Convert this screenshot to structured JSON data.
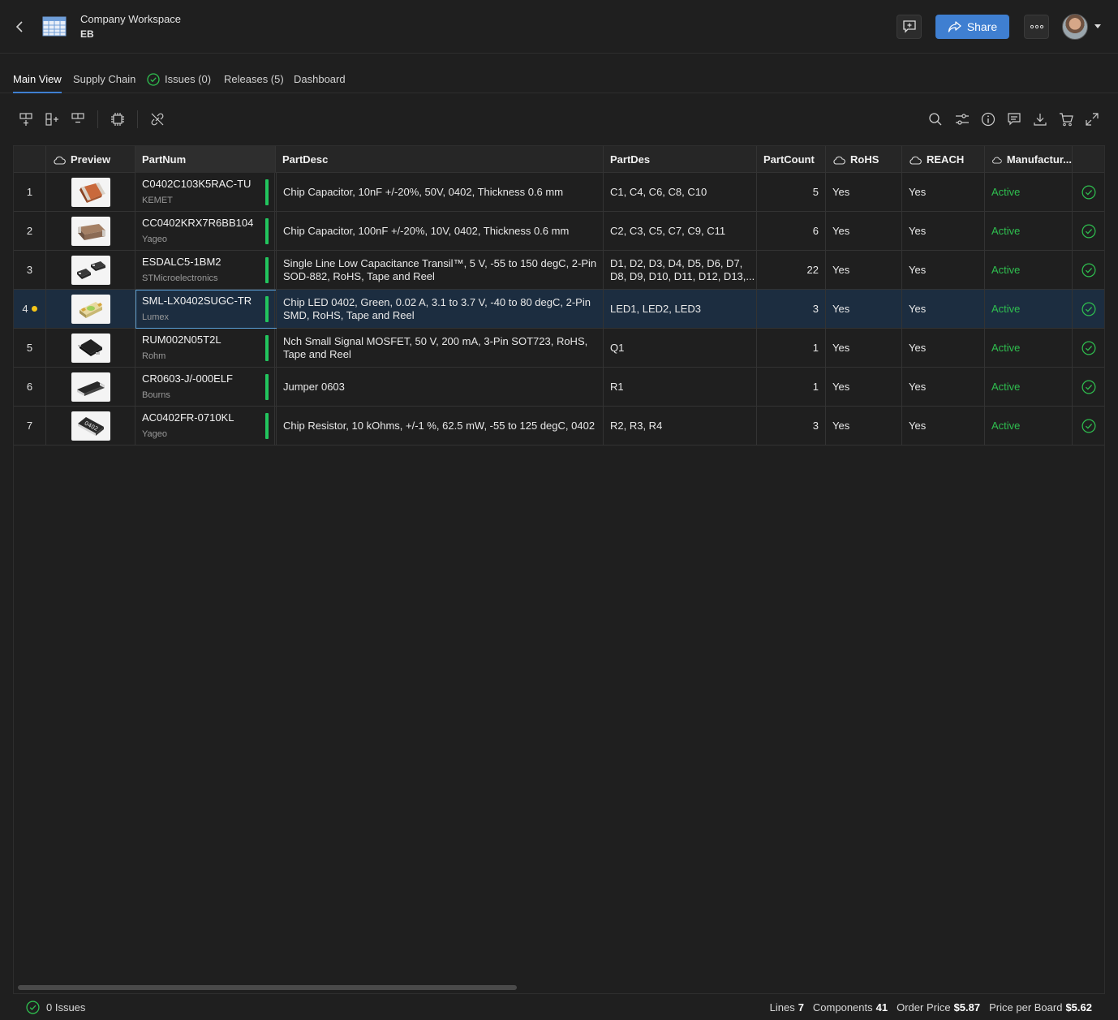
{
  "header": {
    "workspace_title": "Company Workspace",
    "workspace_sub": "EB",
    "share_label": "Share"
  },
  "tabs": [
    {
      "label": "Main View",
      "active": true
    },
    {
      "label": "Supply Chain",
      "active": false
    },
    {
      "label": "Issues (0)",
      "active": false
    },
    {
      "label": "Releases (5)",
      "active": false
    },
    {
      "label": "Dashboard",
      "active": false
    }
  ],
  "columns": {
    "preview": "Preview",
    "partnum": "PartNum",
    "partdesc": "PartDesc",
    "partdes": "PartDes",
    "partcount": "PartCount",
    "rohs": "RoHS",
    "reach": "REACH",
    "manufacturer": "Manufactur..."
  },
  "rows": [
    {
      "index": "1",
      "partnum": "C0402C103K5RAC-TU",
      "mfr": "KEMET",
      "desc": "Chip Capacitor, 10nF +/-20%, 50V, 0402, Thickness 0.6 mm",
      "des": "C1, C4, C6, C8, C10",
      "count": "5",
      "rohs": "Yes",
      "reach": "Yes",
      "status": "Active"
    },
    {
      "index": "2",
      "partnum": "CC0402KRX7R6BB104",
      "mfr": "Yageo",
      "desc": "Chip Capacitor, 100nF +/-20%, 10V, 0402, Thickness 0.6 mm",
      "des": "C2, C3, C5, C7, C9, C11",
      "count": "6",
      "rohs": "Yes",
      "reach": "Yes",
      "status": "Active"
    },
    {
      "index": "3",
      "partnum": "ESDALC5-1BM2",
      "mfr": "STMicroelectronics",
      "desc": "Single Line Low Capacitance Transil™, 5 V, -55 to 150 degC, 2-Pin SOD-882, RoHS, Tape and Reel",
      "des": "D1, D2, D3, D4, D5, D6, D7, D8, D9, D10, D11, D12, D13,...",
      "count": "22",
      "rohs": "Yes",
      "reach": "Yes",
      "status": "Active"
    },
    {
      "index": "4",
      "partnum": "SML-LX0402SUGC-TR",
      "mfr": "Lumex",
      "desc": "Chip LED 0402, Green, 0.02 A, 3.1 to 3.7 V, -40 to 80 degC, 2-Pin SMD, RoHS, Tape and Reel",
      "des": "LED1, LED2, LED3",
      "count": "3",
      "rohs": "Yes",
      "reach": "Yes",
      "status": "Active"
    },
    {
      "index": "5",
      "partnum": "RUM002N05T2L",
      "mfr": "Rohm",
      "desc": "Nch Small Signal MOSFET, 50 V, 200 mA, 3-Pin SOT723, RoHS, Tape and Reel",
      "des": "Q1",
      "count": "1",
      "rohs": "Yes",
      "reach": "Yes",
      "status": "Active"
    },
    {
      "index": "6",
      "partnum": "CR0603-J/-000ELF",
      "mfr": "Bourns",
      "desc": "Jumper 0603",
      "des": "R1",
      "count": "1",
      "rohs": "Yes",
      "reach": "Yes",
      "status": "Active"
    },
    {
      "index": "7",
      "partnum": "AC0402FR-0710KL",
      "mfr": "Yageo",
      "desc": "Chip Resistor, 10 kOhms, +/-1 %, 62.5 mW, -55 to 125 degC, 0402",
      "des": "R2, R3, R4",
      "count": "3",
      "rohs": "Yes",
      "reach": "Yes",
      "status": "Active"
    }
  ],
  "thumb_text": "0402",
  "footer": {
    "issues": "0 Issues",
    "lines_label": "Lines",
    "lines_value": "7",
    "components_label": "Components",
    "components_value": "41",
    "order_price_label": "Order Price",
    "order_price_value": "$5.87",
    "price_board_label": "Price per Board",
    "price_board_value": "$5.62"
  },
  "colors": {
    "accent": "#3f7fd1",
    "active_green": "#2fbf4f",
    "selected_row": "#1c2d40",
    "warning_dot": "#f5c518"
  }
}
